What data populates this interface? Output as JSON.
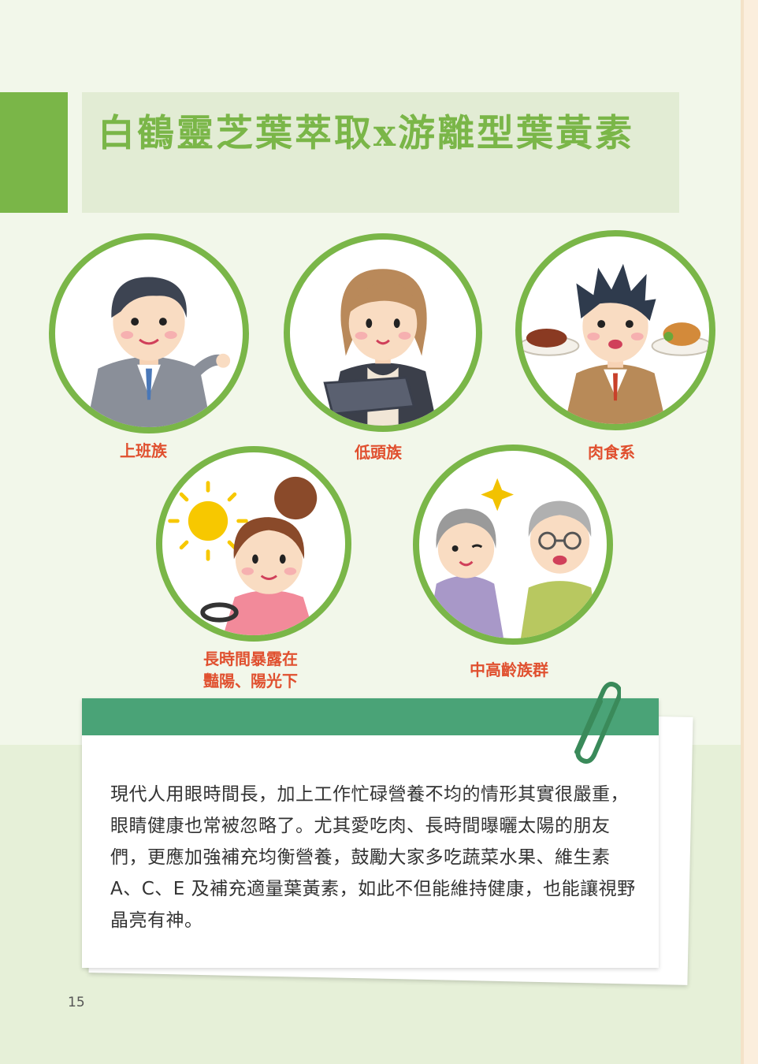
{
  "title": "白鶴靈芝葉萃取x游離型葉黃素",
  "groups": [
    {
      "label": "上班族",
      "icon": "office-worker-illustration"
    },
    {
      "label": "低頭族",
      "icon": "tablet-user-illustration"
    },
    {
      "label": "肉食系",
      "icon": "meat-lover-illustration"
    },
    {
      "label_line1": "長時間暴露在",
      "label_line2": "豔陽、陽光下",
      "icon": "sun-exposure-illustration"
    },
    {
      "label": "中高齡族群",
      "icon": "elderly-couple-illustration"
    }
  ],
  "note": {
    "paragraph": "現代人用眼時間長，加上工作忙碌營養不均的情形其實很嚴重，眼睛健康也常被忽略了。尤其愛吃肉、長時間曝曬太陽的朋友們，更應加強補充均衡營養，鼓勵大家多吃蔬菜水果、維生素A、C、E 及補充適量葉黃素，如此不但能維持健康，也能讓視野晶亮有神。"
  },
  "page_number": "15",
  "colors": {
    "accent_green": "#7ab648",
    "note_bar": "#4aa377",
    "caption_red": "#e0502f",
    "background": "#f2f7ea"
  }
}
